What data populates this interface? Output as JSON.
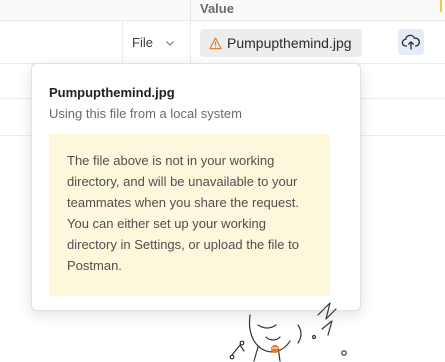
{
  "table": {
    "header": {
      "value_label": "Value"
    },
    "row": {
      "type_value": "File",
      "file_name": "Pumpupthemind.jpg"
    }
  },
  "popover": {
    "title": "Pumpupthemind.jpg",
    "subtitle": "Using this file from a local system",
    "note": "The file above is not in your working directory, and will be unavailable to your teammates when you share the request. You can either set up your working directory in Settings, or upload the file to Postman."
  },
  "icons": {
    "warning": "warning-icon",
    "upload": "cloud-upload-icon",
    "chevron": "chevron-down-icon"
  },
  "colors": {
    "warning": "#d9822b",
    "upload_bg": "#e4ecf7",
    "note_bg": "#fdf7dc",
    "accent_orange": "#e8772e"
  }
}
